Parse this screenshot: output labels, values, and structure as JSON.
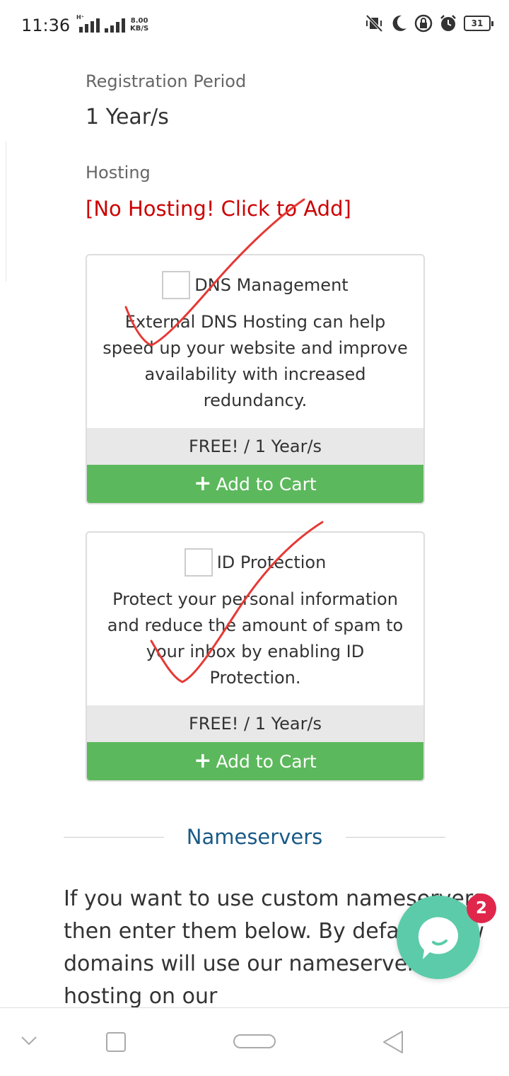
{
  "status_bar": {
    "time": "11:36",
    "net_speed_value": "8.00",
    "net_speed_unit": "KB/S",
    "signal_label": "H⁺",
    "battery": "31",
    "icons": [
      "vibrate-off-icon",
      "moon-icon",
      "lock-rotation-icon",
      "alarm-icon",
      "battery-icon"
    ]
  },
  "registration": {
    "label": "Registration Period",
    "value": "1 Year/s"
  },
  "hosting": {
    "label": "Hosting",
    "link": "[No Hosting! Click to Add]"
  },
  "addons": [
    {
      "name": "DNS Management",
      "description": "External DNS Hosting can help speed up your website and improve availability with increased redundancy.",
      "price": "FREE! / 1 Year/s",
      "button": "Add to Cart",
      "checked": false
    },
    {
      "name": "ID Protection",
      "description": "Protect your personal information and reduce the amount of spam to your inbox by enabling ID Protection.",
      "price": "FREE! / 1 Year/s",
      "button": "Add to Cart",
      "checked": false
    }
  ],
  "nameservers": {
    "title": "Nameservers",
    "text": "If you want to use custom nameservers then enter them below. By default, new domains will use our nameservers for hosting on our"
  },
  "chat": {
    "badge": "2"
  },
  "colors": {
    "hosting_link": "#cc0000",
    "add_button": "#5cb85c",
    "price_bar": "#e8e8e8",
    "nameservers_title": "#1a5a87",
    "chat_fab": "#5ccbaa",
    "chat_badge": "#e0274b",
    "annotation": "#e53935"
  }
}
